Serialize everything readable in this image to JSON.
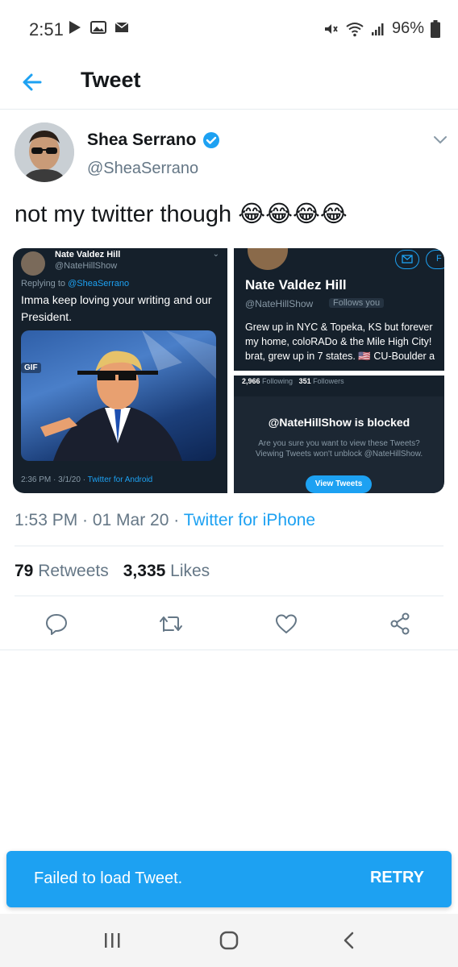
{
  "status_bar": {
    "time": "2:51",
    "battery": "96%",
    "icons": [
      "play-icon",
      "image-icon",
      "mail-icon",
      "mute-icon",
      "wifi-icon",
      "signal-icon",
      "battery-icon"
    ]
  },
  "header": {
    "title": "Tweet",
    "back_icon": "back-arrow-icon"
  },
  "tweet": {
    "author_name": "Shea Serrano",
    "author_handle": "@SheaSerrano",
    "verified": true,
    "text": "not my twitter though 😂😂😂😂",
    "timestamp": "1:53 PM · 01 Mar 20 · ",
    "source": "Twitter for iPhone",
    "retweets_count": "79",
    "retweets_label": "Retweets",
    "likes_count": "3,335",
    "likes_label": "Likes"
  },
  "media": {
    "left": {
      "name": "Nate Valdez Hill",
      "handle": "@NateHillShow",
      "replying_prefix": "Replying to ",
      "replying_to": "@SheaSerrano",
      "text": "Imma keep loving your writing and our President.",
      "gif_badge": "GIF",
      "meta_time": "2:36 PM · 3/1/20 · ",
      "meta_source": "Twitter for Android"
    },
    "right_top": {
      "name": "Nate Valdez Hill",
      "handle": "@NateHillShow",
      "follows_you": "Follows you",
      "bio_line1": "Grew up in NYC & Topeka, KS but forever",
      "bio_line2": "my home, coloRADo & the Mile High City!",
      "bio_line3": "brat, grew up in 7 states. 🇺🇸 CU-Boulder a"
    },
    "right_bottom": {
      "following_count": "2,966",
      "following_label": "Following",
      "followers_count": "351",
      "followers_label": "Followers",
      "blocked_title": "@NateHillShow is blocked",
      "blocked_desc": "Are you sure you want to view these Tweets? Viewing Tweets won't unblock @NateHillShow.",
      "view_button": "View Tweets"
    }
  },
  "actions": [
    "reply-icon",
    "retweet-icon",
    "like-icon",
    "share-icon"
  ],
  "toast": {
    "message": "Failed to load Tweet.",
    "retry": "RETRY"
  },
  "nav": [
    "recent-apps-icon",
    "home-icon",
    "back-icon"
  ],
  "colors": {
    "accent": "#1da1f2",
    "text": "#14171a",
    "secondary": "#657786",
    "dark_bg": "#15202b"
  }
}
